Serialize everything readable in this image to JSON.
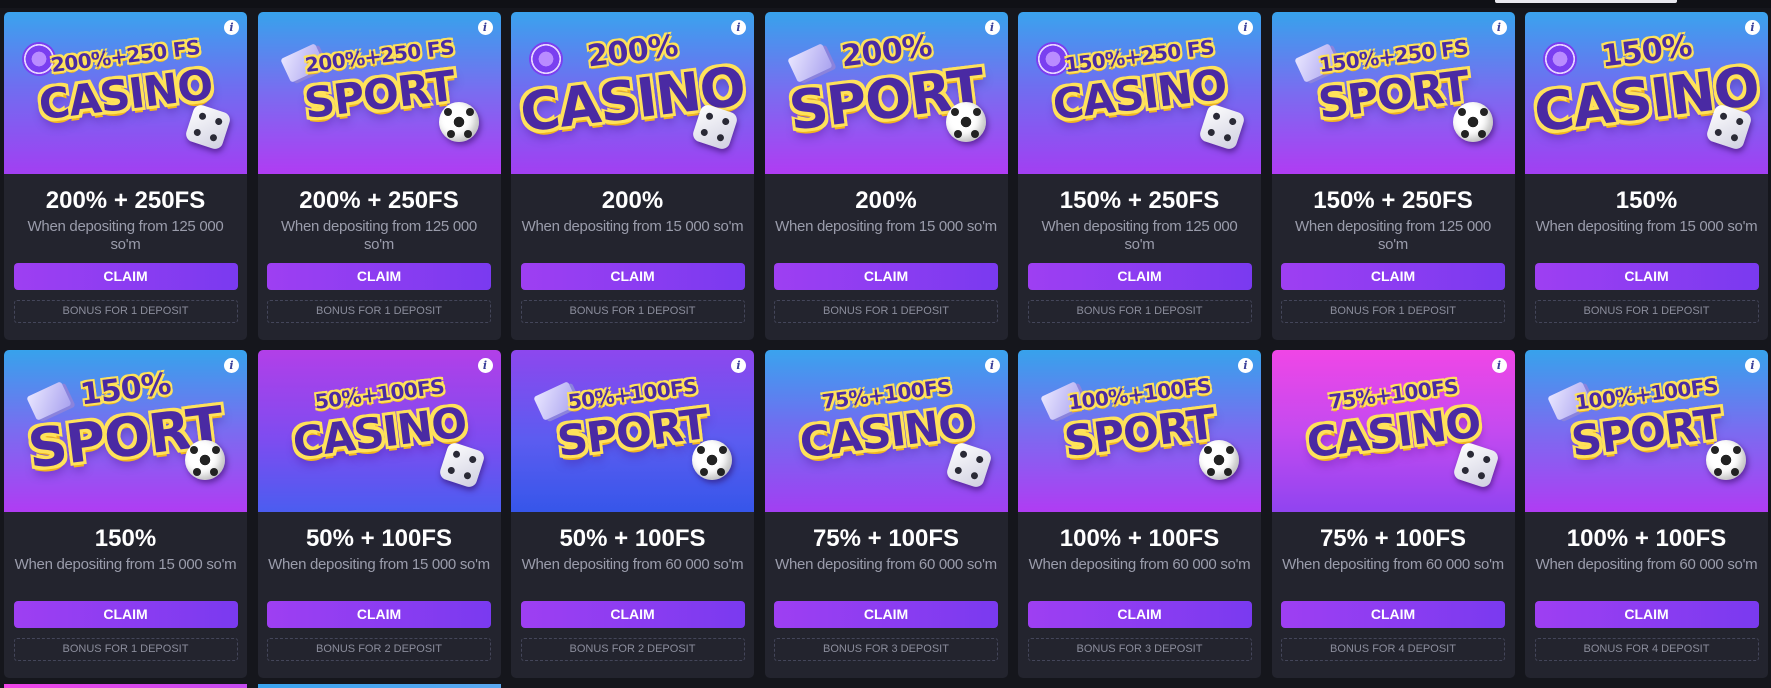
{
  "colors": {
    "page_bg": "#15161c",
    "card_bg": "#23242e",
    "claim_start": "#9e3ff2",
    "claim_end": "#7a3af0",
    "art_text": "#4a2aa3",
    "art_outline": "#ffe25a"
  },
  "claim_label": "CLAIM",
  "cards": [
    {
      "banner_top": "200%+250 FS",
      "banner_main": "CASINO",
      "banner_icon_left": "casino-chip-icon",
      "banner_icon_right": "dice-icon",
      "amount": "200% + 250FS",
      "description": "When depositing from 125 000 so'm",
      "bonus": "BONUS FOR 1 DEPOSIT"
    },
    {
      "banner_top": "200%+250 FS",
      "banner_main": "SPORT",
      "banner_icon_left": "cash-icon",
      "banner_icon_right": "soccer-ball-icon",
      "amount": "200% + 250FS",
      "description": "When depositing from 125 000 so'm",
      "bonus": "BONUS FOR 1 DEPOSIT"
    },
    {
      "banner_top": "200%",
      "banner_main": "CASINO",
      "banner_icon_left": "casino-chip-icon",
      "banner_icon_right": "dice-icon",
      "amount": "200%",
      "description": "When depositing from 15 000 so'm",
      "bonus": "BONUS FOR 1 DEPOSIT"
    },
    {
      "banner_top": "200%",
      "banner_main": "SPORT",
      "banner_icon_left": "cash-icon",
      "banner_icon_right": "soccer-ball-icon",
      "amount": "200%",
      "description": "When depositing from 15 000 so'm",
      "bonus": "BONUS FOR 1 DEPOSIT"
    },
    {
      "banner_top": "150%+250 FS",
      "banner_main": "CASINO",
      "banner_icon_left": "casino-chip-icon",
      "banner_icon_right": "dice-icon",
      "amount": "150% + 250FS",
      "description": "When depositing from 125 000 so'm",
      "bonus": "BONUS FOR 1 DEPOSIT"
    },
    {
      "banner_top": "150%+250 FS",
      "banner_main": "SPORT",
      "banner_icon_left": "cash-icon",
      "banner_icon_right": "soccer-ball-icon",
      "amount": "150% + 250FS",
      "description": "When depositing from 125 000 so'm",
      "bonus": "BONUS FOR 1 DEPOSIT"
    },
    {
      "banner_top": "150%",
      "banner_main": "CASINO",
      "banner_icon_left": "casino-chip-icon",
      "banner_icon_right": "dice-icon",
      "amount": "150%",
      "description": "When depositing from 15 000 so'm",
      "bonus": "BONUS FOR 1 DEPOSIT"
    },
    {
      "banner_top": "150%",
      "banner_main": "SPORT",
      "banner_icon_left": "cash-icon",
      "banner_icon_right": "soccer-ball-icon",
      "amount": "150%",
      "description": "When depositing from 15 000 so'm",
      "bonus": "BONUS FOR 1 DEPOSIT"
    },
    {
      "banner_top": "50%+100FS",
      "banner_main": "CASINO",
      "banner_icon_left": "",
      "banner_icon_right": "dice-icon",
      "amount": "50% + 100FS",
      "description": "When depositing from 15 000 so'm",
      "bonus": "BONUS FOR 2 DEPOSIT"
    },
    {
      "banner_top": "50%+100FS",
      "banner_main": "SPORT",
      "banner_icon_left": "cash-icon",
      "banner_icon_right": "soccer-ball-icon",
      "amount": "50% + 100FS",
      "description": "When depositing from 60 000 so'm",
      "bonus": "BONUS FOR 2 DEPOSIT"
    },
    {
      "banner_top": "75%+100FS",
      "banner_main": "CASINO",
      "banner_icon_left": "",
      "banner_icon_right": "dice-icon",
      "amount": "75% + 100FS",
      "description": "When depositing from 60 000 so'm",
      "bonus": "BONUS FOR 3 DEPOSIT"
    },
    {
      "banner_top": "100%+100FS",
      "banner_main": "SPORT",
      "banner_icon_left": "cash-icon",
      "banner_icon_right": "soccer-ball-icon",
      "amount": "100% + 100FS",
      "description": "When depositing from 60 000 so'm",
      "bonus": "BONUS FOR 3 DEPOSIT"
    },
    {
      "banner_top": "75%+100FS",
      "banner_main": "CASINO",
      "banner_icon_left": "",
      "banner_icon_right": "dice-icon",
      "amount": "75% + 100FS",
      "description": "When depositing from 60 000 so'm",
      "bonus": "BONUS FOR 4 DEPOSIT"
    },
    {
      "banner_top": "100%+100FS",
      "banner_main": "SPORT",
      "banner_icon_left": "cash-icon",
      "banner_icon_right": "soccer-ball-icon",
      "amount": "100% + 100FS",
      "description": "When depositing from 60 000 so'm",
      "bonus": "BONUS FOR 4 DEPOSIT"
    }
  ]
}
